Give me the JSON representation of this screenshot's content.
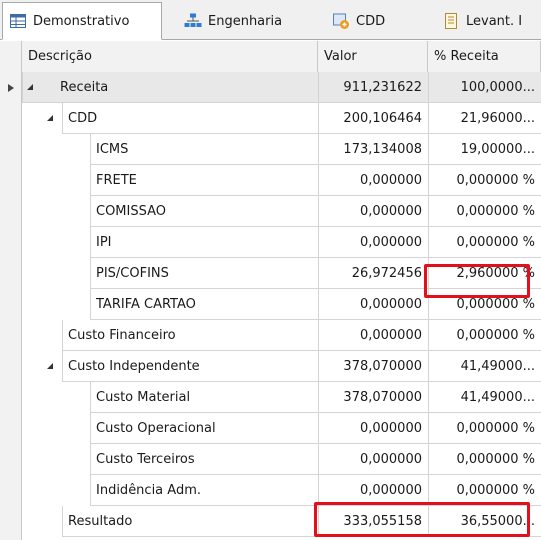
{
  "tabs": [
    {
      "label": "Demonstrativo",
      "icon": "table-icon",
      "active": true
    },
    {
      "label": "Engenharia",
      "icon": "org-chart-icon",
      "active": false
    },
    {
      "label": "CDD",
      "icon": "cdd-icon",
      "active": false
    },
    {
      "label": "Levant. I",
      "icon": "document-icon",
      "active": false
    }
  ],
  "columns": {
    "descricao": "Descrição",
    "valor": "Valor",
    "receita": "% Receita"
  },
  "rows": [
    {
      "name": "Receita",
      "valor": "911,231622",
      "pct": "100,0000..."
    },
    {
      "name": "CDD",
      "valor": "200,106464",
      "pct": "21,96000..."
    },
    {
      "name": "ICMS",
      "valor": "173,134008",
      "pct": "19,00000..."
    },
    {
      "name": "FRETE",
      "valor": "0,000000",
      "pct": "0,000000 %"
    },
    {
      "name": "COMISSAO",
      "valor": "0,000000",
      "pct": "0,000000 %"
    },
    {
      "name": "IPI",
      "valor": "0,000000",
      "pct": "0,000000 %"
    },
    {
      "name": "PIS/COFINS",
      "valor": "26,972456",
      "pct": "2,960000 %"
    },
    {
      "name": "TARIFA CARTAO",
      "valor": "0,000000",
      "pct": "0,000000 %"
    },
    {
      "name": "Custo Financeiro",
      "valor": "0,000000",
      "pct": "0,000000 %"
    },
    {
      "name": "Custo Independente",
      "valor": "378,070000",
      "pct": "41,49000..."
    },
    {
      "name": "Custo Material",
      "valor": "378,070000",
      "pct": "41,49000..."
    },
    {
      "name": "Custo Operacional",
      "valor": "0,000000",
      "pct": "0,000000 %"
    },
    {
      "name": "Custo Terceiros",
      "valor": "0,000000",
      "pct": "0,000000 %"
    },
    {
      "name": "Indidência Adm.",
      "valor": "0,000000",
      "pct": "0,000000 %"
    },
    {
      "name": "Resultado",
      "valor": "333,055158",
      "pct": "36,55000..."
    }
  ],
  "colors": {
    "highlight": "#e3101c"
  }
}
